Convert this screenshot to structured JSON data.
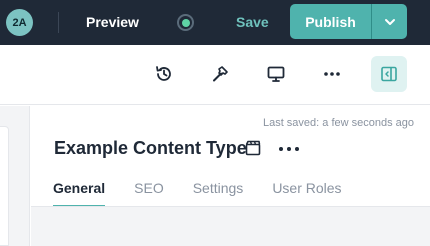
{
  "header": {
    "avatar_initials": "2A",
    "preview_label": "Preview",
    "save_label": "Save",
    "publish_label": "Publish",
    "status": "connected"
  },
  "toolbar": {
    "icons": [
      "history-icon",
      "hammer-icon",
      "monitor-icon",
      "more-icon",
      "panel-toggle-icon"
    ]
  },
  "panel": {
    "last_saved": "Last saved: a few seconds ago",
    "title": "Example Content Type",
    "tabs": [
      {
        "label": "General",
        "active": true
      },
      {
        "label": "SEO",
        "active": false
      },
      {
        "label": "Settings",
        "active": false
      },
      {
        "label": "User Roles",
        "active": false
      }
    ]
  },
  "colors": {
    "topbar_bg": "#1f2937",
    "accent": "#4fb3ad",
    "status_green": "#5fd3a5"
  }
}
